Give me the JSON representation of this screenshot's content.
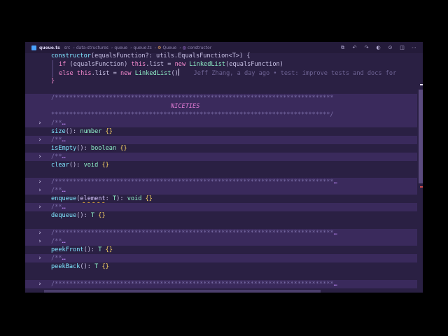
{
  "tab": {
    "filename": "queue.ts",
    "breadcrumb": [
      "src",
      "data-structures",
      "queue",
      "queue.ts"
    ],
    "class_name": "Queue",
    "method_name": "constructor"
  },
  "code": {
    "constructor_kw": "constructor",
    "constructor_params": "(equalsFunction?: utils.EqualsFunction<T>) {",
    "if_kw": "if",
    "if_cond": "(equalsFunction) ",
    "this_kw": "this",
    "list_assign": ".list = ",
    "new_kw": "new",
    "linked_list": " LinkedList",
    "arg": "(equalsFunction)",
    "else_kw": "else",
    "else_rest": ".list = ",
    "linked_list2": " LinkedList",
    "empty_args": "()",
    "blame": "Jeff Zhang, a day ago • test: improve tests and docs for",
    "close_brace": "}",
    "stars_top": "/*****************************************************************************",
    "niceties": "NICETIES",
    "stars_bottom": "*****************************************************************************/",
    "doc_open": "/**",
    "ellipsis": "…",
    "size_fn": "size",
    "size_sig": "(): ",
    "number_type": "number",
    "fn_body": " {}",
    "is_empty_fn": "isEmpty",
    "boolean_type": "boolean",
    "clear_fn": "clear",
    "void_type": "void",
    "stars_collapsed": "/*****************************************************************************",
    "enqueue_fn": "enqueue",
    "enqueue_param": "element",
    "enqueue_colon": ": ",
    "generic_t": "T",
    "enqueue_close": "): ",
    "dequeue_fn": "dequeue",
    "peek_front_fn": "peekFront",
    "peek_back_fn": "peekBack"
  },
  "colors": {
    "editor_bg": "#2a2043",
    "highlight_bg": "#3a2a5c",
    "keyword": "#f78bd0",
    "function": "#7fe6ff",
    "type": "#8ff0c8",
    "comment": "#7b6ea8"
  }
}
